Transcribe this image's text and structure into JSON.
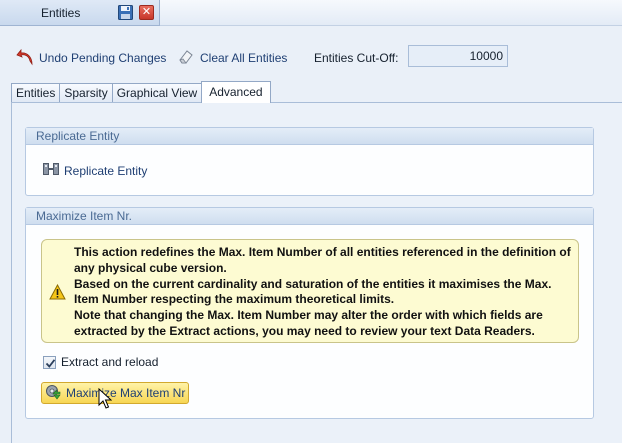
{
  "document_tab": {
    "title": "Entities",
    "icons": [
      "save-icon",
      "close-icon"
    ],
    "close_glyph": "✕"
  },
  "toolbar": {
    "undo_label": "Undo Pending Changes",
    "undo_icon": "undo-arrow-icon",
    "clear_label": "Clear All Entities",
    "clear_icon": "eraser-icon",
    "cutoff_label": "Entities Cut-Off:",
    "cutoff_value": "10000"
  },
  "tabs": [
    {
      "label": "Entities",
      "active": false
    },
    {
      "label": "Sparsity",
      "active": false
    },
    {
      "label": "Graphical View",
      "active": false
    },
    {
      "label": "Advanced",
      "active": true
    }
  ],
  "replicate_group": {
    "header": "Replicate Entity",
    "button_label": "Replicate Entity",
    "button_icon": "replicate-icon"
  },
  "maximize_group": {
    "header": "Maximize Item Nr.",
    "warning_icon": "warning-icon",
    "warning_lines": [
      "This action redefines the Max. Item Number of all entities referenced in the definition of any physical cube version.",
      "Based on the current cardinality and saturation of the entities it maximises the Max. Item Number respecting the maximum theoretical limits.",
      "Note that changing the Max. Item Number may alter the order with which fields are extracted by the Extract actions, you may need to review your text Data Readers."
    ],
    "checkbox_label": "Extract and reload",
    "checkbox_checked": true,
    "button_label": "Maximize Max Item Nr",
    "button_icon": "maximize-gear-icon"
  },
  "colors": {
    "accent_text": "#1f3f73",
    "group_header_text": "#4a6a93",
    "warning_bg": "#fdfbd2",
    "button_highlight": "#f7d654"
  }
}
